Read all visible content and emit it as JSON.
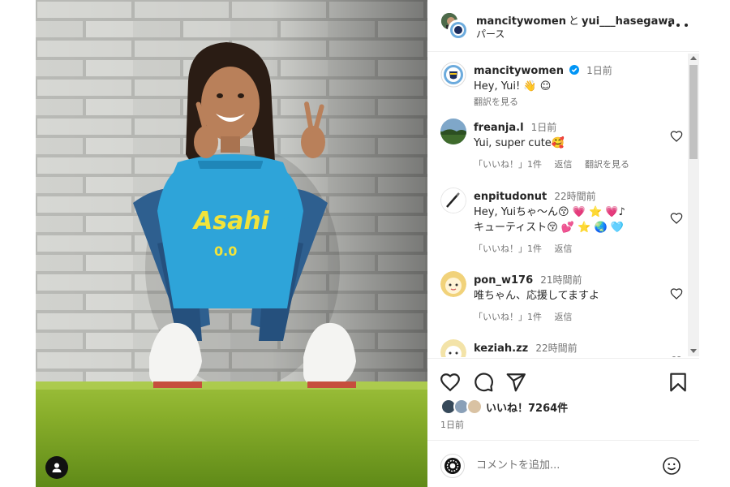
{
  "post": {
    "author": "mancitywomen",
    "conjunction": "と",
    "collaborator": "yui___hasegawa",
    "location": "パース"
  },
  "comments": [
    {
      "user": "mancitywomen",
      "time": "1日前",
      "text": "Hey, Yui! 👋 ☺",
      "translate": "翻訳を見る",
      "verified": true,
      "avatar": "man-city-crest"
    },
    {
      "user": "freanja.l",
      "time": "1日前",
      "text": "Yui, super cute🥰",
      "likes": "「いいね！」1件",
      "reply": "返信",
      "translate": "翻訳を見る",
      "avatar": "landscape-photo"
    },
    {
      "user": "enpitudonut",
      "time": "22時間前",
      "line1": "Hey, Yuiちゃ〜ん😚 💗 ⭐ 💗♪",
      "line2": "キューティスト😚 💕 ⭐ 🌏 🩵",
      "likes": "「いいね！」1件",
      "reply": "返信",
      "avatar": "pencil-sketch"
    },
    {
      "user": "pon_w176",
      "time": "21時間前",
      "text": "唯ちゃん、応援してますよ",
      "likes": "「いいね！」1件",
      "reply": "返信",
      "avatar": "cartoon-character"
    },
    {
      "user": "keziah.zz",
      "time": "22時間前",
      "avatar": "cartoon-face"
    }
  ],
  "actions": {
    "likes": "いいね！7264件",
    "time": "1日前"
  },
  "add_comment": {
    "placeholder": "コメントを追加..."
  },
  "colors": {
    "verified": "#0095f6",
    "jersey": "#2ea4d9",
    "sponsor_text": "#f2e33a"
  }
}
